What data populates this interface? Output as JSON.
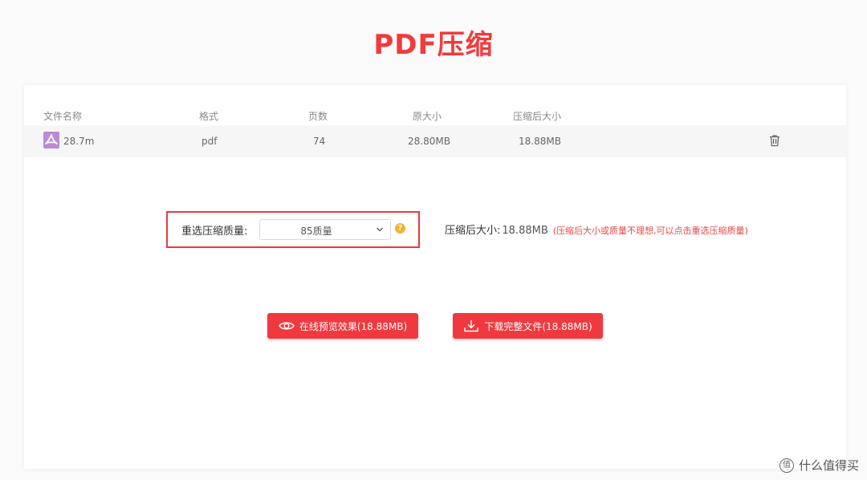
{
  "page": {
    "title": "PDF压缩"
  },
  "table": {
    "headers": {
      "name": "文件名称",
      "format": "格式",
      "pages": "页数",
      "original_size": "原大小",
      "compressed_size": "压缩后大小"
    },
    "rows": [
      {
        "name": "28.7m",
        "format": "pdf",
        "pages": "74",
        "original_size": "28.80MB",
        "compressed_size": "18.88MB",
        "icon": "pdf-icon"
      }
    ]
  },
  "quality": {
    "label": "重选压缩质量:",
    "selected": "85质量",
    "help": "?",
    "result_label": "压缩后大小:",
    "result_value": "18.88MB",
    "hint": "(压缩后大小或质量不理想,可以点击重选压缩质量)"
  },
  "buttons": {
    "preview": "在线预览效果(18.88MB)",
    "download": "下载完整文件(18.88MB)"
  },
  "watermark": {
    "text": "什么值得买",
    "icon": "值"
  },
  "colors": {
    "accent": "#f0393f",
    "highlight_border": "#e83a3a",
    "hint": "#e84848",
    "pdf_icon": "#b98bd6",
    "help_icon": "#f2b13b"
  }
}
